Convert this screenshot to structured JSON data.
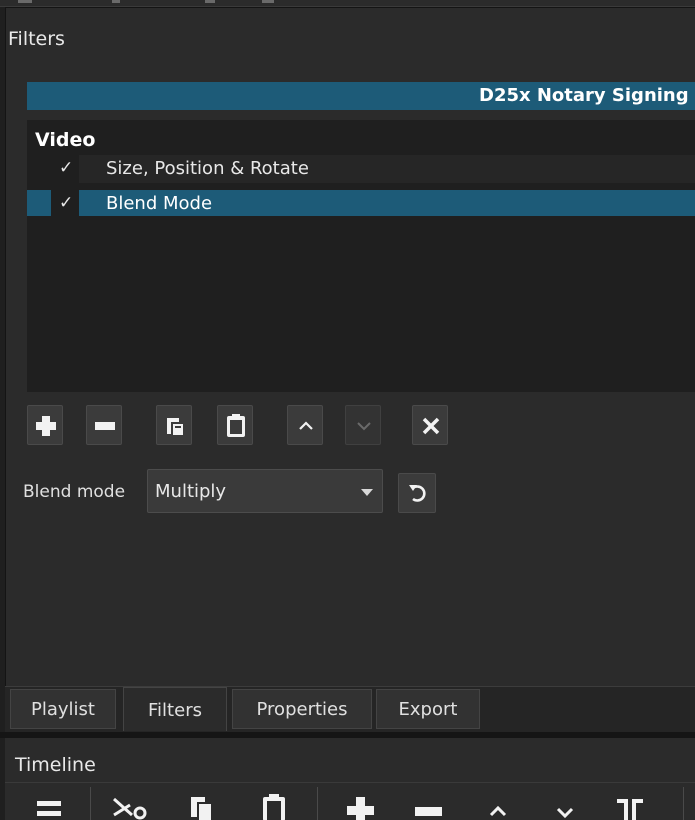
{
  "panel": {
    "title": "Filters"
  },
  "clip": {
    "name": "D25x Notary Signing"
  },
  "filters": {
    "group": "Video",
    "items": [
      {
        "check": "✓",
        "label": "Size, Position & Rotate",
        "selected": false
      },
      {
        "check": "✓",
        "label": "Blend Mode",
        "selected": true
      }
    ]
  },
  "toolbar": {
    "buttons": [
      {
        "icon": "plus-icon"
      },
      {
        "icon": "minus-icon"
      },
      {
        "icon": "copy-icon"
      },
      {
        "icon": "paste-icon"
      },
      {
        "icon": "chevron-up-icon"
      },
      {
        "icon": "chevron-down-icon"
      },
      {
        "icon": "close-icon"
      }
    ]
  },
  "blend": {
    "label": "Blend mode",
    "value": "Multiply"
  },
  "tabs": [
    {
      "label": "Playlist",
      "active": false
    },
    {
      "label": "Filters",
      "active": true
    },
    {
      "label": "Properties",
      "active": false
    },
    {
      "label": "Export",
      "active": false
    }
  ],
  "timeline": {
    "title": "Timeline",
    "toolbar_icons": [
      "menu-icon",
      "cut-icon",
      "copy-icon",
      "paste-icon",
      "append-icon",
      "remove-icon",
      "lift-icon",
      "overwrite-icon",
      "split-icon"
    ]
  },
  "colors": {
    "accent": "#1d5b78",
    "panel": "#2b2b2b",
    "list": "#1f1f1f"
  }
}
